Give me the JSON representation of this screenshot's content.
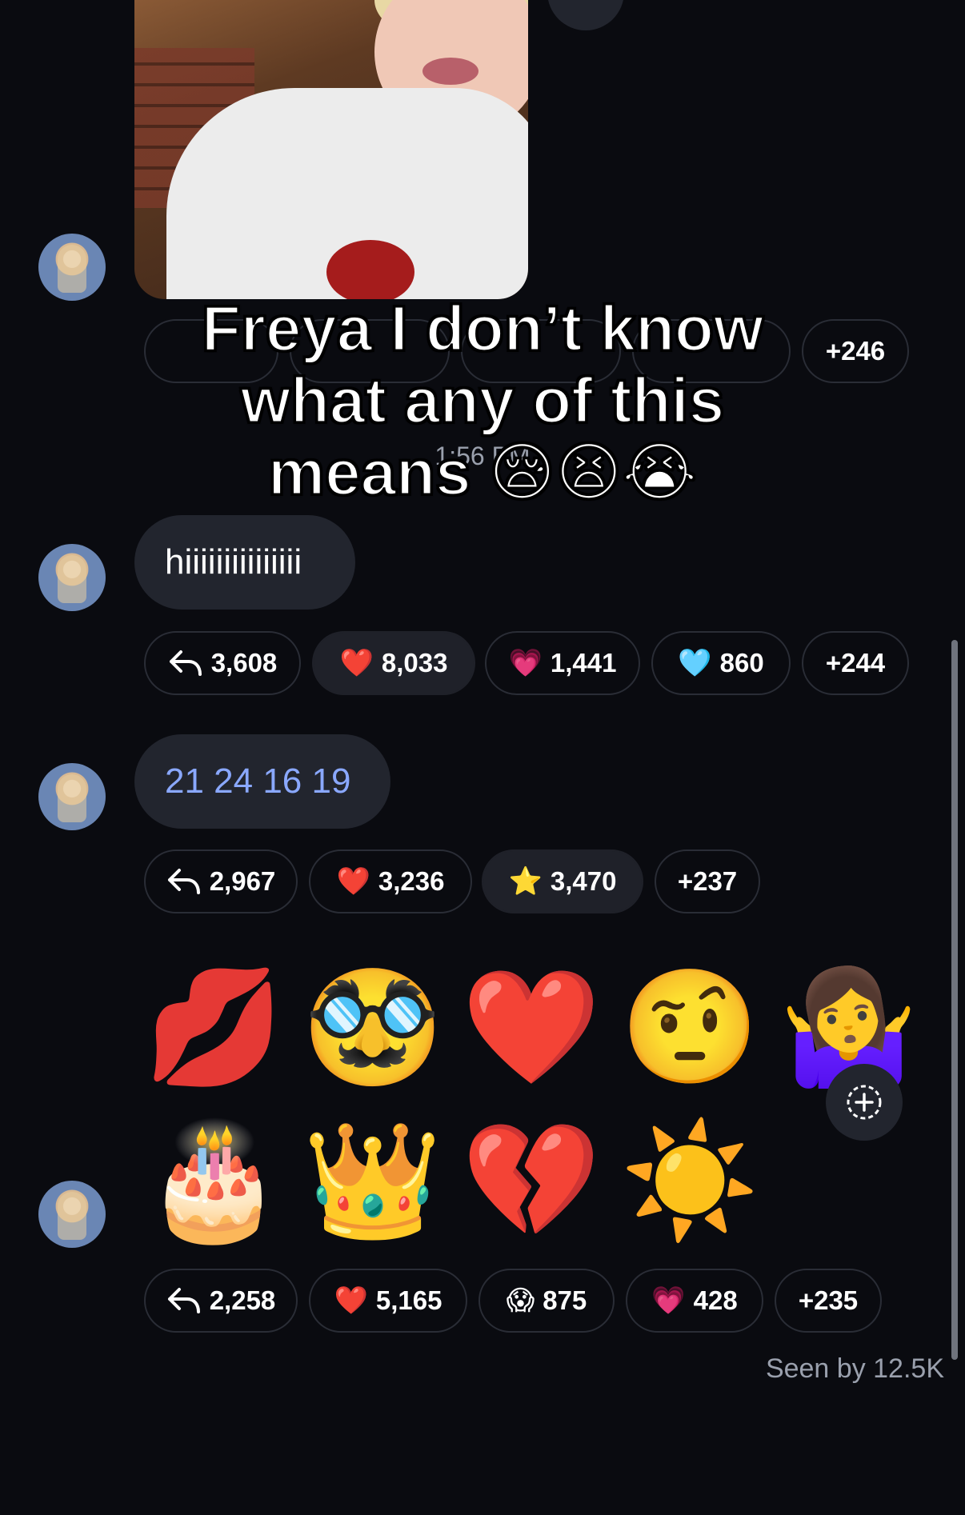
{
  "overlay_caption": "Freya I don’t know what any of this means 😪😫😭",
  "timestamp": "1:56 PM",
  "messages": [
    {
      "text": "hiiiiiiiiiiiiiii",
      "reactions": [
        {
          "icon": "reply-icon",
          "count": "3,608"
        },
        {
          "icon": "❤️",
          "count": "8,033"
        },
        {
          "icon": "💗",
          "count": "1,441"
        },
        {
          "icon": "🩵",
          "count": "860"
        },
        {
          "icon": "",
          "count": "+244"
        }
      ]
    },
    {
      "text": "21 24 16 19",
      "reactions": [
        {
          "icon": "reply-icon",
          "count": "2,967"
        },
        {
          "icon": "❤️",
          "count": "3,236"
        },
        {
          "icon": "⭐",
          "count": "3,470"
        },
        {
          "icon": "",
          "count": "+237"
        }
      ]
    },
    {
      "emojis_row1": [
        "💋",
        "🥸",
        "❤️",
        "🤨",
        "🤷‍♀️"
      ],
      "emojis_row2": [
        "🎂",
        "👑",
        "💔",
        "☀️"
      ],
      "reactions": [
        {
          "icon": "reply-icon",
          "count": "2,258"
        },
        {
          "icon": "❤️",
          "count": "5,165"
        },
        {
          "icon": "😱",
          "count": "875"
        },
        {
          "icon": "💗",
          "count": "428"
        },
        {
          "icon": "",
          "count": "+235"
        }
      ]
    }
  ],
  "top_reactions_last": "+246",
  "seen_by": "Seen by 12.5K",
  "colors": {
    "background": "#0a0b10",
    "bubble": "#22252e",
    "link_blue": "#8aa8ff"
  }
}
